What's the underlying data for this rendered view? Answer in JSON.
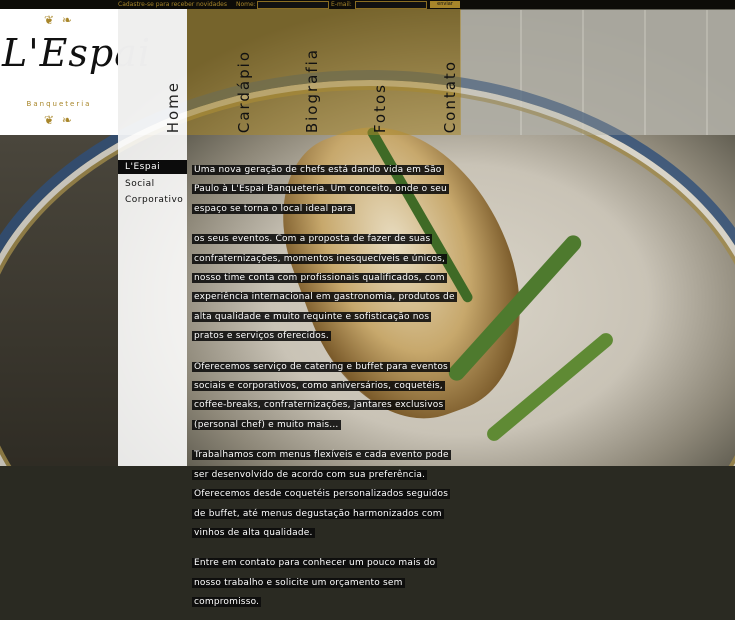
{
  "newsletter": {
    "prompt": "Cadastre-se para receber novidades",
    "name_label": "Nome:",
    "email_label": "E-mail:",
    "submit_label": "enviar"
  },
  "logo": {
    "brand": "L'Espai",
    "subtitle": "Banqueteria"
  },
  "nav": {
    "items": [
      {
        "label": "Home"
      },
      {
        "label": "Cardápio"
      },
      {
        "label": "Biografia"
      },
      {
        "label": "Fotos"
      },
      {
        "label": "Contato"
      }
    ]
  },
  "submenu": {
    "items": [
      {
        "label": "L'Espai"
      },
      {
        "label": "Social"
      },
      {
        "label": "Corporativo"
      }
    ]
  },
  "content": {
    "p1": "Uma nova geração de chefs está dando vida em São Paulo à L'Espai Banqueteria. Um conceito, onde o seu espaço se torna o local ideal para",
    "p2": "os seus eventos. Com a proposta de fazer de suas confraternizações, momentos inesquecíveis e únicos, nosso time conta com profissionais qualificados, com experiência internacional em gastronomia, produtos de alta qualidade e muito requinte e sofisticação nos pratos e serviços oferecidos.",
    "p3": "Oferecemos serviço de catering e buffet para eventos sociais e corporativos, como aniversários, coquetéis, coffee-breaks, confraternizações, jantares exclusivos (personal chef) e muito mais...",
    "p4": "Trabalhamos com menus flexíveis e cada evento pode ser desenvolvido de acordo com sua preferência. Oferecemos desde coquetéis personalizados seguidos de buffet, até menus degustação harmonizados com vinhos de alta qualidade.",
    "p5": "Entre em contato para conhecer um pouco mais do nosso trabalho e solicite um orçamento sem compromisso."
  },
  "colors": {
    "accent": "#a8862a",
    "text_bg": "#0c0c0c"
  }
}
